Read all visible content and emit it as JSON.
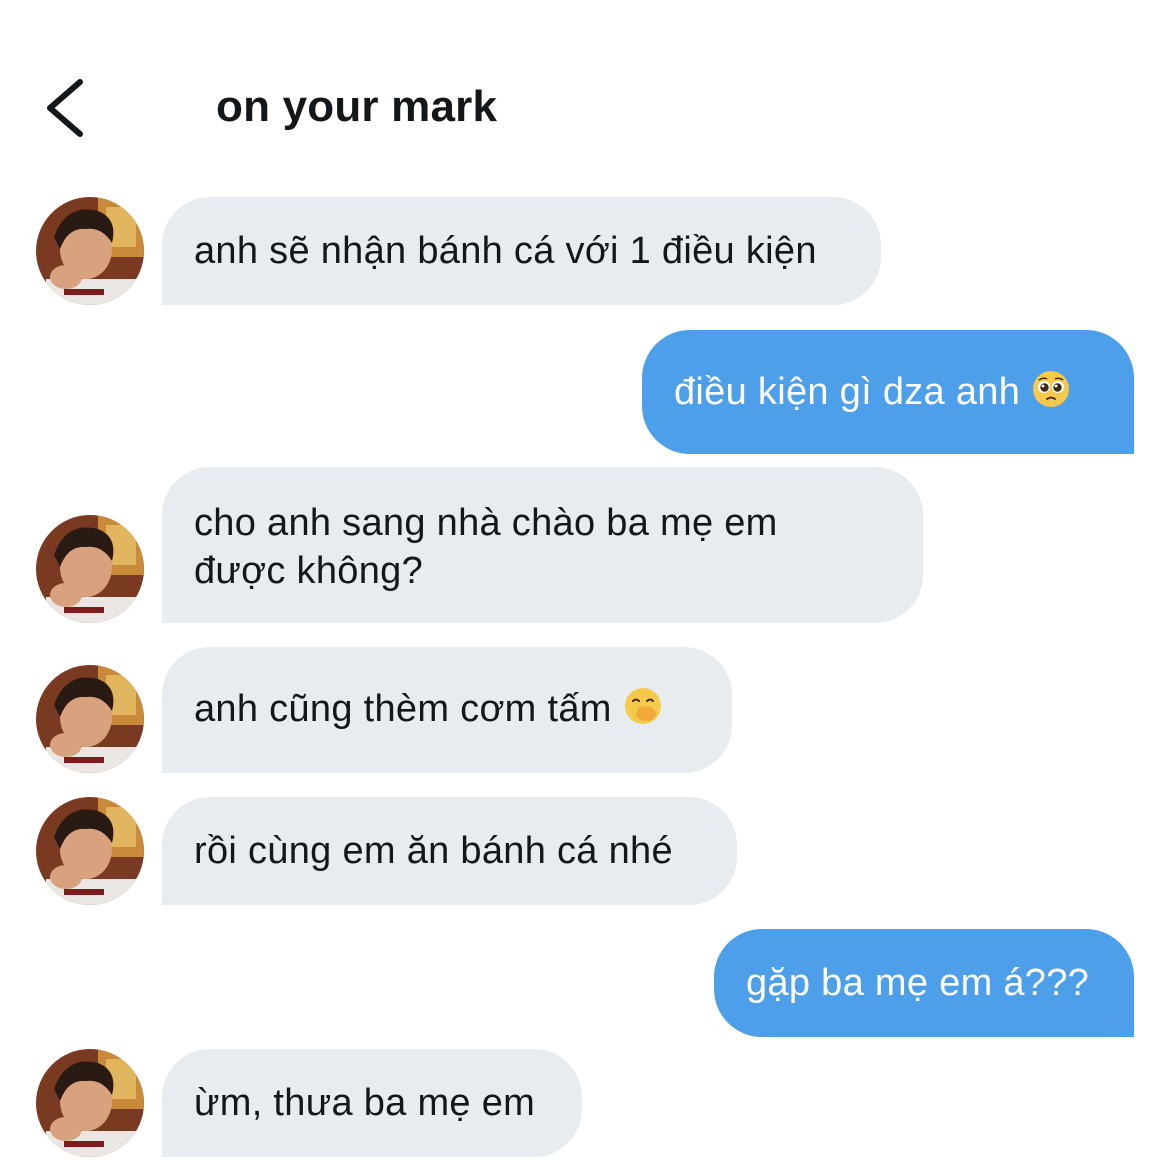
{
  "header": {
    "title": "on your mark"
  },
  "icons": {
    "back": "chevron-left-icon",
    "pleading": "pleading-face-emoji",
    "giggle": "hand-over-mouth-emoji",
    "avatar": "user-avatar"
  },
  "colors": {
    "incoming_bubble": "#e6ecf0",
    "outgoing_bubble": "#4c9fe8",
    "text": "#14171a"
  },
  "messages": [
    {
      "side": "in",
      "text": "anh sẽ nhận bánh cá với 1 điều kiện"
    },
    {
      "side": "out",
      "text": "điều kiện gì dza anh",
      "emoji": "🥺"
    },
    {
      "side": "in",
      "line1": "cho anh sang nhà chào ba mẹ em",
      "line2": "được không?"
    },
    {
      "side": "in",
      "text": "anh cũng thèm cơm tấm",
      "emoji": "🤭"
    },
    {
      "side": "in",
      "text": "rồi cùng em ăn bánh cá nhé"
    },
    {
      "side": "out",
      "text": "gặp ba mẹ em á???"
    },
    {
      "side": "in",
      "text": "ừm, thưa ba mẹ em"
    }
  ]
}
